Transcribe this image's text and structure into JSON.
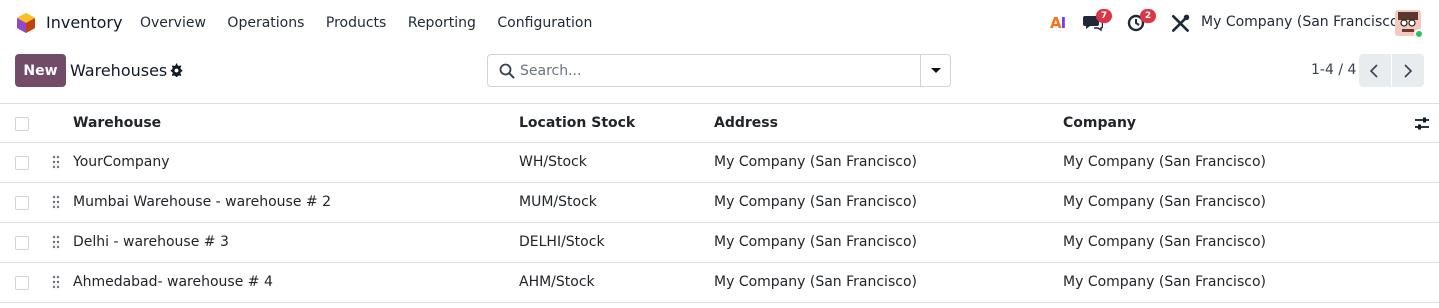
{
  "navbar": {
    "app_name": "Inventory",
    "menu": [
      "Overview",
      "Operations",
      "Products",
      "Reporting",
      "Configuration"
    ],
    "ai_label_a": "A",
    "ai_label_i": "I",
    "messages_badge": "7",
    "activities_badge": "2",
    "company": "My Company (San Francisco)"
  },
  "control_panel": {
    "new_label": "New",
    "title": "Warehouses",
    "search_placeholder": "Search...",
    "pager": "1-4 / 4"
  },
  "table": {
    "headers": {
      "warehouse": "Warehouse",
      "location_stock": "Location Stock",
      "address": "Address",
      "company": "Company"
    },
    "rows": [
      {
        "warehouse": "YourCompany",
        "location_stock": "WH/Stock",
        "address": "My Company (San Francisco)",
        "company": "My Company (San Francisco)"
      },
      {
        "warehouse": "Mumbai Warehouse - warehouse # 2",
        "location_stock": "MUM/Stock",
        "address": "My Company (San Francisco)",
        "company": "My Company (San Francisco)"
      },
      {
        "warehouse": "Delhi - warehouse # 3",
        "location_stock": "DELHI/Stock",
        "address": "My Company (San Francisco)",
        "company": "My Company (San Francisco)"
      },
      {
        "warehouse": "Ahmedabad- warehouse # 4",
        "location_stock": "AHM/Stock",
        "address": "My Company (San Francisco)",
        "company": "My Company (San Francisco)"
      }
    ]
  },
  "colors": {
    "brand": "#714b67",
    "badge": "#dc3545",
    "online": "#22c55e"
  }
}
